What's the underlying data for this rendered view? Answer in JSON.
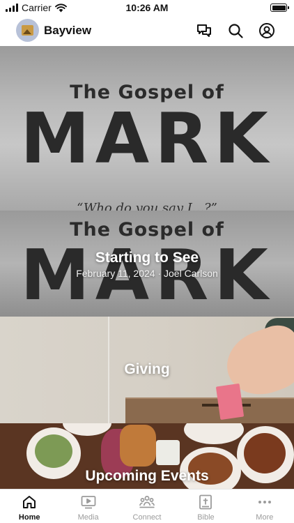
{
  "status_bar": {
    "carrier": "Carrier",
    "time": "10:26 AM"
  },
  "header": {
    "title": "Bayview",
    "icons": [
      "chat-icon",
      "search-icon",
      "profile-icon"
    ]
  },
  "hero": {
    "line1": "The Gospel of",
    "line2": "MARK",
    "script_text": "“Who do you say I...?”",
    "carousel_pages": 2,
    "carousel_active_index": 0
  },
  "sermon": {
    "banner_line1": "The Gospel of",
    "banner_line2": "MARK",
    "title": "Starting to See",
    "meta": "February 11, 2024 · Joel Carlson"
  },
  "giving": {
    "title": "Giving"
  },
  "events": {
    "title": "Upcoming Events"
  },
  "tabs": [
    {
      "label": "Home",
      "icon": "home-icon",
      "active": true
    },
    {
      "label": "Media",
      "icon": "media-icon",
      "active": false
    },
    {
      "label": "Connect",
      "icon": "connect-icon",
      "active": false
    },
    {
      "label": "Bible",
      "icon": "bible-icon",
      "active": false
    },
    {
      "label": "More",
      "icon": "more-icon",
      "active": false
    }
  ],
  "colors": {
    "active_tab": "#111111",
    "inactive_tab": "#9b9b9b"
  }
}
